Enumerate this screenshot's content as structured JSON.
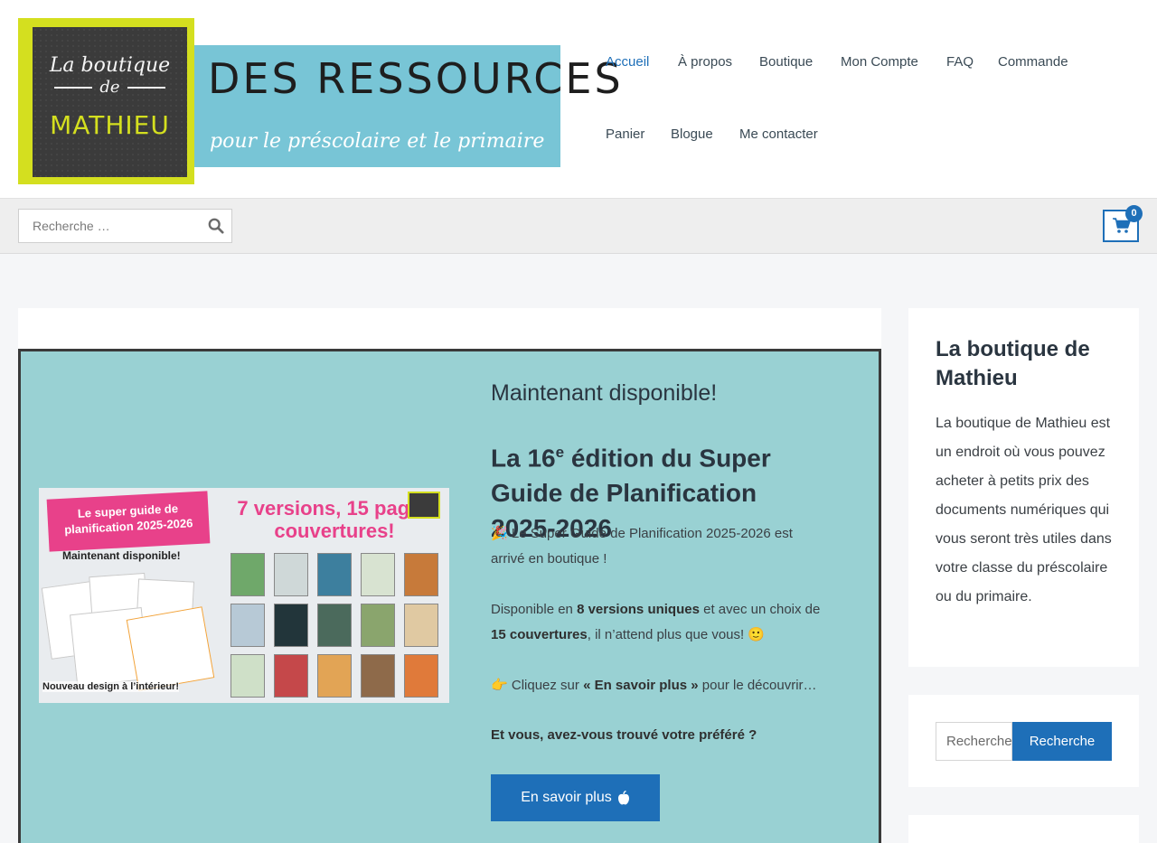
{
  "logo": {
    "chalk_line1": "La boutique",
    "chalk_de": "de",
    "chalk_line2": "MATHIEU",
    "title": "DES RESSOURCES",
    "subtitle": "pour le préscolaire et le primaire"
  },
  "nav": {
    "items": [
      {
        "label": "Accueil",
        "active": true
      },
      {
        "label": "À propos"
      },
      {
        "label": "Boutique"
      },
      {
        "label": "Mon Compte"
      },
      {
        "label": "FAQ"
      },
      {
        "label": "Commande"
      },
      {
        "label": "Panier"
      },
      {
        "label": "Blogue"
      },
      {
        "label": "Me contacter"
      }
    ]
  },
  "search": {
    "placeholder": "Recherche …",
    "icon": "search-icon"
  },
  "cart": {
    "icon": "shopping-cart-icon",
    "count": "0"
  },
  "promo": {
    "kicker": "Maintenant disponible!",
    "title_prefix": "La 16",
    "title_sup": "e",
    "title_suffix": " édition du Super Guide de Planification 2025-2026",
    "p1_emoji": "🎉",
    "p1_text": " Le Super Guide de Planification 2025-2026 est arrivé en boutique !",
    "p2_a": "Disponible en ",
    "p2_b": "8 versions uniques",
    "p2_c": " et avec un choix de ",
    "p2_d": "15 couvertures",
    "p2_e": ", il n’attend plus que vous! 🙂",
    "p3_emoji": "👉",
    "p3_a": " Cliquez sur ",
    "p3_b": "« En savoir plus »",
    "p3_c": " pour le découvrir…",
    "p4": "Et vous, avez-vous trouvé votre préféré ?",
    "button_label": "En savoir plus",
    "button_icon": "apple-icon",
    "image": {
      "banner": "Le super guide de planification 2025-2026",
      "dispo": "Maintenant disponible!",
      "headline": "7 versions, 15 pages couvertures!",
      "new_design": "Nouveau design à l’intérieur!"
    }
  },
  "sidebar": {
    "about_title": "La boutique de Mathieu",
    "about_text": "La boutique de Mathieu est un endroit où vous pouvez acheter à petits prix des documents numériques qui vous seront très utiles dans votre classe du préscolaire ou du primaire.",
    "search_placeholder": "Recherche",
    "search_button": "Recherche"
  },
  "colors": {
    "accent": "#1e6fb8",
    "promo_bg": "#99d1d3",
    "logo_band": "#78c5d6",
    "logo_yellow": "#d4df1f",
    "pink": "#e8418a"
  }
}
